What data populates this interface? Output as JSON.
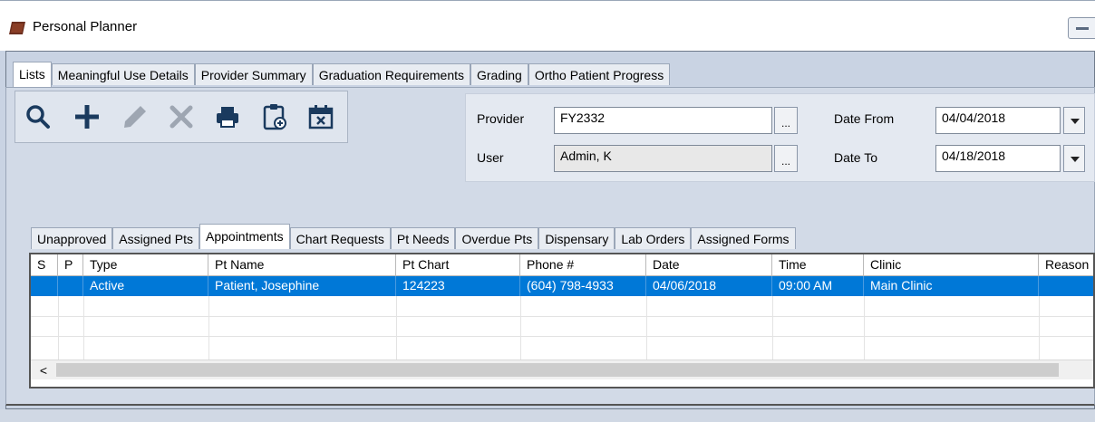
{
  "window": {
    "title": "Personal Planner"
  },
  "tabs": [
    {
      "label": "Lists",
      "active": true
    },
    {
      "label": "Meaningful Use Details"
    },
    {
      "label": "Provider Summary"
    },
    {
      "label": "Graduation Requirements"
    },
    {
      "label": "Grading"
    },
    {
      "label": "Ortho Patient Progress"
    }
  ],
  "toolbar": {
    "icons": [
      "search-icon",
      "add-icon",
      "edit-icon",
      "delete-icon",
      "print-icon",
      "clipboard-add-icon",
      "calendar-remove-icon"
    ]
  },
  "filters": {
    "provider_label": "Provider",
    "provider_value": "FY2332",
    "user_label": "User",
    "user_value": "Admin, K",
    "date_from_label": "Date From",
    "date_from_value": "04/04/2018",
    "date_to_label": "Date To",
    "date_to_value": "04/18/2018",
    "ellipsis": "..."
  },
  "inner_tabs": [
    {
      "label": "Unapproved"
    },
    {
      "label": "Assigned Pts"
    },
    {
      "label": "Appointments",
      "active": true
    },
    {
      "label": "Chart Requests"
    },
    {
      "label": "Pt Needs"
    },
    {
      "label": "Overdue Pts"
    },
    {
      "label": "Dispensary"
    },
    {
      "label": "Lab Orders"
    },
    {
      "label": "Assigned Forms"
    }
  ],
  "grid": {
    "columns": [
      "S",
      "P",
      "Type",
      "Pt Name",
      "Pt Chart",
      "Phone #",
      "Date",
      "Time",
      "Clinic",
      "Reason"
    ],
    "rows": [
      [
        "",
        "",
        "Active",
        "Patient, Josephine",
        "124223",
        "(604) 798-4933",
        "04/06/2018",
        "09:00 AM",
        "Main Clinic",
        ""
      ]
    ],
    "selection_color": "#0078d7",
    "scroll_left_arrow": "<"
  }
}
